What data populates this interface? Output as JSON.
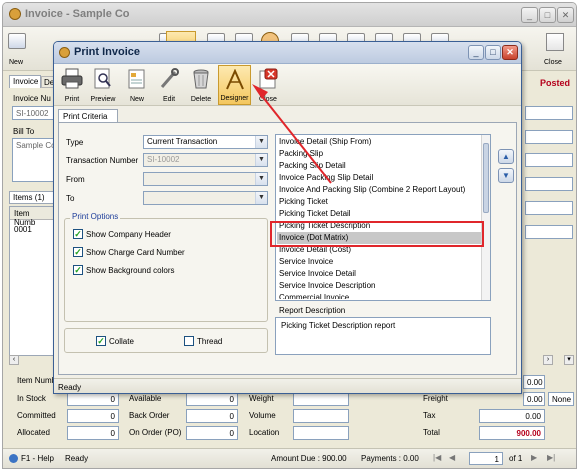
{
  "main": {
    "title": "Invoice - Sample Co",
    "toolbar": {
      "new_label": "New",
      "close_label": "Close"
    },
    "status_posted": "Posted",
    "tabs": [
      "Invoice",
      "De"
    ],
    "invoice_number_label": "Invoice Nu",
    "invoice_number_value": "SI-10002",
    "bill_to_label": "Bill To",
    "bill_to_value": "Sample Co",
    "items_tab": "Items (1)",
    "item_number_header": "Item Numb",
    "item_row_value": "0001",
    "bottom": {
      "item_number_label": "Item Numb",
      "in_stock_label": "In Stock",
      "committed_label": "Committed",
      "allocated_label": "Allocated",
      "available_label": "Available",
      "back_order_label": "Back Order",
      "on_order_label": "On Order (PO)",
      "weight_label": "Weight",
      "volume_label": "Volume",
      "location_label": "Location",
      "freight_label": "Freight",
      "tax_label": "Tax",
      "total_label": "Total",
      "zero": "0",
      "freight_value": "0.00",
      "tax_value": "0.00",
      "total_value": "900.00",
      "item_number_amount": "0.00",
      "none_label": "None"
    },
    "statusbar": {
      "help": "F1 - Help",
      "ready": "Ready",
      "amount_due": "Amount Due : 900.00",
      "payments": "Payments : 0.00",
      "page": "1",
      "of_pages": "of 1"
    }
  },
  "dialog": {
    "title": "Print Invoice",
    "toolbar": [
      {
        "label": "Print",
        "icon": "printer-icon"
      },
      {
        "label": "Preview",
        "icon": "preview-icon"
      },
      {
        "label": "New",
        "icon": "new-doc-icon"
      },
      {
        "label": "Edit",
        "icon": "edit-tools-icon"
      },
      {
        "label": "Delete",
        "icon": "trash-icon"
      },
      {
        "label": "Designer",
        "icon": "designer-icon"
      },
      {
        "label": "Close",
        "icon": "close-doc-icon"
      }
    ],
    "tab": "Print Criteria",
    "type_label": "Type",
    "type_value": "Current Transaction",
    "transaction_number_label": "Transaction Number",
    "transaction_number_value": "SI-10002",
    "from_label": "From",
    "to_label": "To",
    "print_options_title": "Print Options",
    "options": [
      {
        "label": "Show Company Header",
        "checked": true
      },
      {
        "label": "Show Charge Card Number",
        "checked": true
      },
      {
        "label": "Show Background colors",
        "checked": true
      }
    ],
    "collate_label": "Collate",
    "collate_checked": true,
    "thread_label": "Thread",
    "thread_checked": false,
    "reports": [
      "Invoice Detail (Ship From)",
      "Packing Slip",
      "Packing Slip Detail",
      "Invoice Packing Slip Detail",
      "Invoice And Packing Slip (Combine 2 Report Layout)",
      "Picking Ticket",
      "Picking Ticket Detail",
      "Picking Ticket Description",
      "Invoice (Dot Matrix)",
      "Invoice Detail (Cost)",
      "Service Invoice",
      "Service Invoice Detail",
      "Service Invoice Description",
      "Commercial Invoice"
    ],
    "selected_report_index": 8,
    "report_description_label": "Report Description",
    "report_description_value": "Picking Ticket Description report",
    "status": "Ready"
  },
  "colors": {
    "highlight": "#e0262b",
    "title_bar": "#bdcbe0",
    "accent_total": "#b5001c"
  }
}
